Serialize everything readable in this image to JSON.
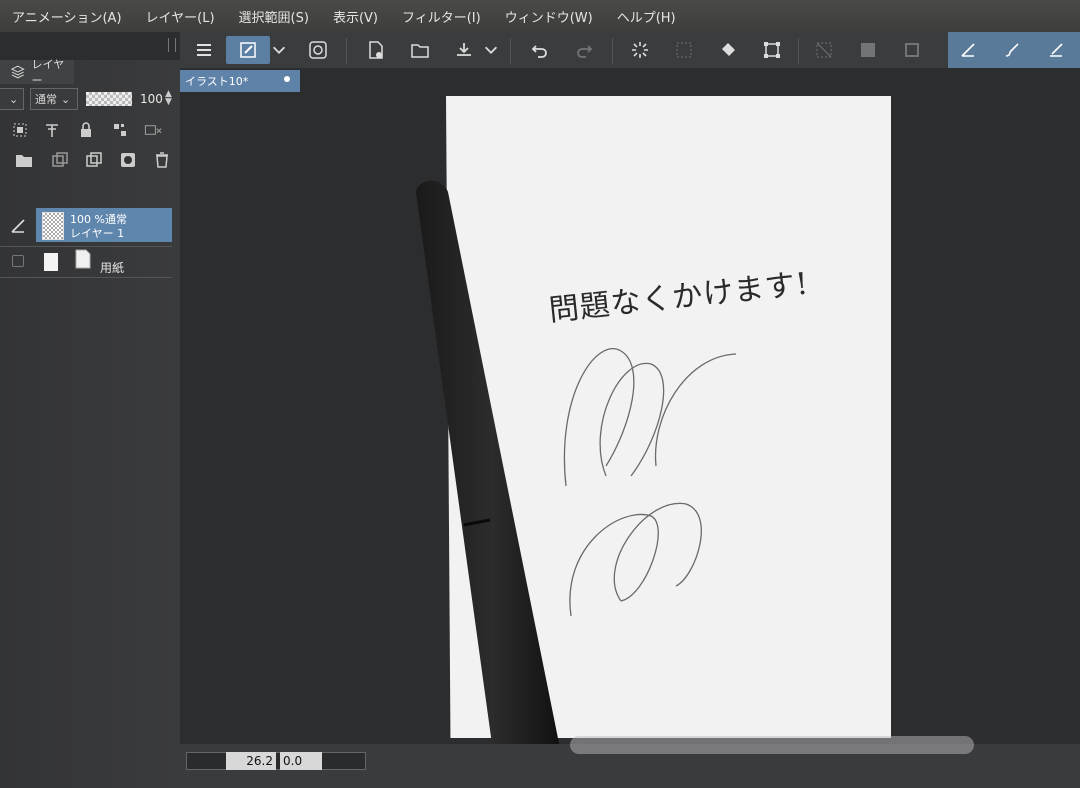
{
  "menu": [
    "アニメーション(A)",
    "レイヤー(L)",
    "選択範囲(S)",
    "表示(V)",
    "フィルター(I)",
    "ウィンドウ(W)",
    "ヘルプ(H)"
  ],
  "layer_panel": {
    "tab_label": "レイヤー",
    "blend_mode": "通常",
    "opacity": "100"
  },
  "layers": [
    {
      "line1": "100 %通常",
      "line2": "レイヤー 1"
    },
    {
      "label": "用紙"
    }
  ],
  "document": {
    "tab_title": "イラスト10*"
  },
  "canvas": {
    "handwriting": "問題なくかけます!"
  },
  "status": {
    "zoom": "26.2",
    "rotation": "0.0"
  },
  "colors": {
    "accent": "#5f86ad",
    "menubar": "#434441",
    "paper": "#f2f2f3"
  }
}
